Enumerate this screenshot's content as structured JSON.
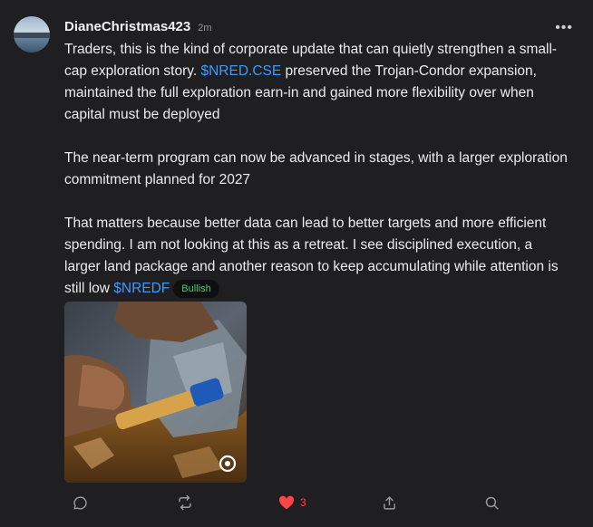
{
  "post": {
    "username": "DianeChristmas423",
    "timestamp": "2m",
    "paragraphs": {
      "p1_prefix": "Traders, this is the kind of corporate update that can quietly strengthen a small-cap exploration story. ",
      "p1_ticker": "$NRED.CSE",
      "p1_suffix": " preserved the Trojan-Condor expansion, maintained the full exploration earn-in and gained more flexibility over when capital must be deployed",
      "p2": "The near-term program can now be advanced in stages, with a larger exploration commitment planned for 2027",
      "p3_prefix": "That matters because better data can lead to better targets and more efficient spending. I am not looking at this as a retreat. I see disciplined execution, a larger land package and another reason to keep accumulating while attention is still low ",
      "p3_ticker": "$NREDF"
    },
    "sentiment_badge": "Bullish",
    "likes_count": "3"
  },
  "icons": {
    "more": "more-options-icon",
    "comment": "comment-icon",
    "repost": "repost-icon",
    "like": "heart-icon",
    "share": "share-icon",
    "search": "search-icon",
    "video": "video-play-icon"
  },
  "colors": {
    "background": "#1f1f22",
    "text": "#ececec",
    "ticker": "#3d9bff",
    "bullish": "#43c979",
    "like": "#ff4545",
    "muted": "#9a9aa0"
  }
}
